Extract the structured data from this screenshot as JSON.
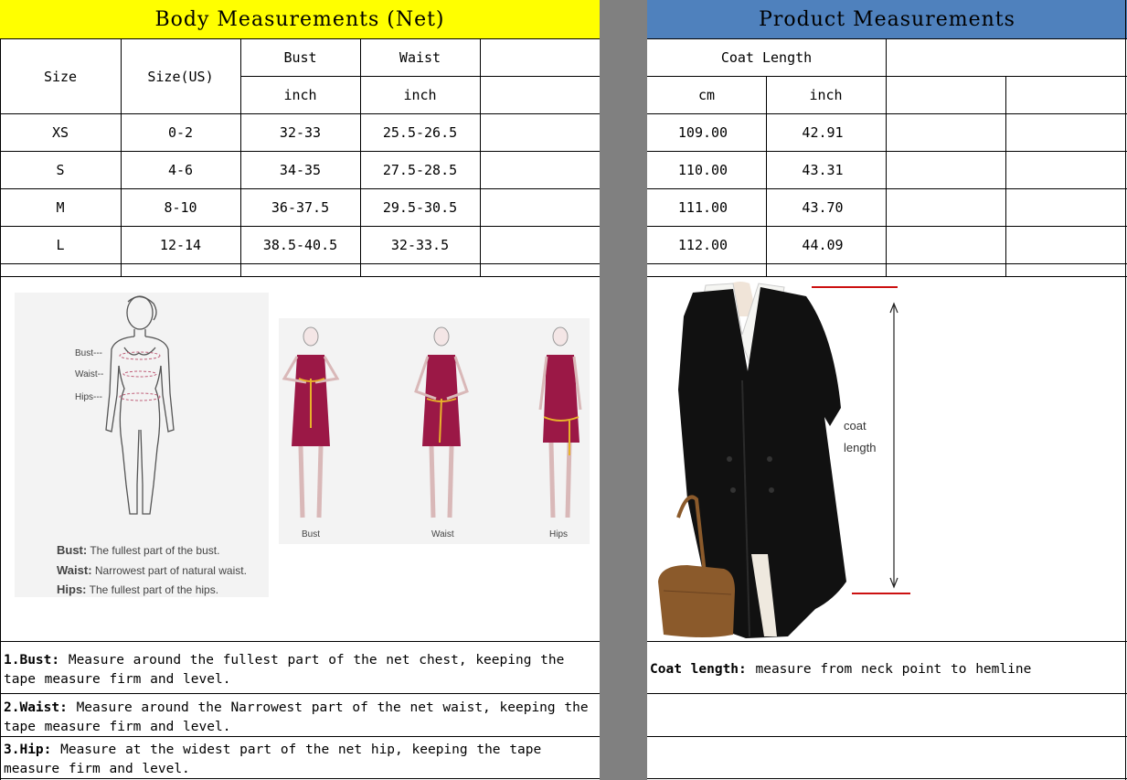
{
  "body_measurements": {
    "title": "Body Measurements (Net)",
    "col_size": "Size",
    "col_size_us": "Size(US)",
    "col_bust": "Bust",
    "col_waist": "Waist",
    "unit_bust": "inch",
    "unit_waist": "inch",
    "rows": [
      {
        "size": "XS",
        "size_us": "0-2",
        "bust": "32-33",
        "waist": "25.5-26.5"
      },
      {
        "size": "S",
        "size_us": "4-6",
        "bust": "34-35",
        "waist": "27.5-28.5"
      },
      {
        "size": "M",
        "size_us": "8-10",
        "bust": "36-37.5",
        "waist": "29.5-30.5"
      },
      {
        "size": "L",
        "size_us": "12-14",
        "bust": "38.5-40.5",
        "waist": "32-33.5"
      }
    ]
  },
  "product_measurements": {
    "title": "Product Measurements",
    "col_coat_length": "Coat Length",
    "unit_cm": "cm",
    "unit_inch": "inch",
    "rows": [
      {
        "cm": "109.00",
        "inch": "42.91"
      },
      {
        "cm": "110.00",
        "inch": "43.31"
      },
      {
        "cm": "111.00",
        "inch": "43.70"
      },
      {
        "cm": "112.00",
        "inch": "44.09"
      }
    ]
  },
  "body_figure": {
    "bust_marker": "Bust---",
    "waist_marker": "Waist--",
    "hips_marker": "Hips---",
    "bust_term": "Bust:",
    "bust_def": "The fullest part of the bust.",
    "waist_term": "Waist:",
    "waist_def": "Narrowest part of natural waist.",
    "hips_term": "Hips:",
    "hips_def": "The fullest part of the hips."
  },
  "dress_figure": {
    "label_bust": "Bust",
    "label_waist": "Waist",
    "label_hips": "Hips",
    "dress_color": "#9b1846",
    "tape_color": "#e8b32a"
  },
  "coat_figure": {
    "label_line1": "coat",
    "label_line2": "length",
    "coat_color": "#111111",
    "bag_color": "#8b5a2b",
    "marker_color": "#cc1111"
  },
  "notes": {
    "bust_label": "1.Bust:",
    "bust_text": " Measure around the fullest part of the net chest, keeping the tape  measure firm and level.",
    "waist_label": "2.Waist:",
    "waist_text": " Measure around the Narrowest part of the net waist, keeping the tape  measure firm and level.",
    "hip_label": "3.Hip:",
    "hip_text": " Measure at the widest part of the net hip, keeping the tape measure firm and level.",
    "coat_label": "Coat length:",
    "coat_text": " measure from neck point to hemline"
  },
  "colors": {
    "header_left_bg": "#ffff00",
    "header_right_bg": "#4f81bd",
    "separator": "#808080"
  }
}
